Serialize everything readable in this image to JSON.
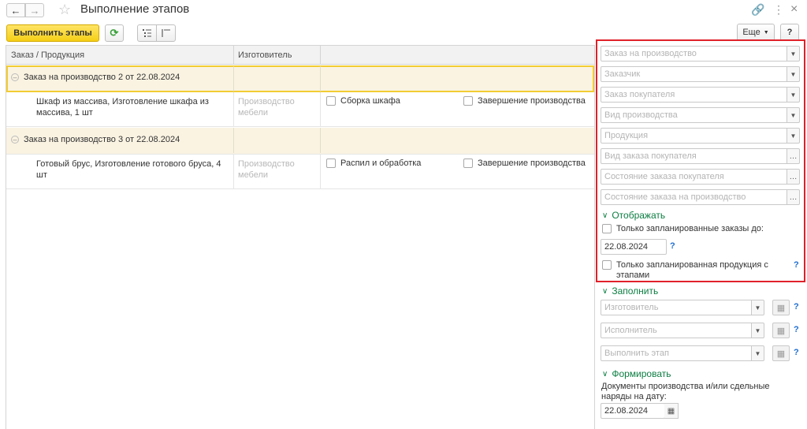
{
  "window": {
    "title": "Выполнение этапов",
    "back_icon": "←",
    "forward_icon": "→",
    "star_icon": "☆",
    "link_icon": "🔗",
    "menu_icon": "⋮",
    "close_icon": "×"
  },
  "toolbar": {
    "run_label": "Выполнить этапы",
    "refresh_icon": "⟳",
    "more_label": "Еще",
    "help_label": "?"
  },
  "table": {
    "columns": [
      "Заказ / Продукция",
      "Изготовитель"
    ],
    "groups": [
      {
        "title": "Заказ на производство 2 от 22.08.2024",
        "row": {
          "product": "Шкаф из массива, Изготовление шкафа из массива, 1 шт",
          "maker": "Производство мебели",
          "stage1": "Сборка шкафа",
          "stage2": "Завершение производства"
        }
      },
      {
        "title": "Заказ на производство 3 от 22.08.2024",
        "row": {
          "product": "Готовый брус, Изготовление готового бруса, 4 шт",
          "maker": "Производство мебели",
          "stage1": "Распил и обработка",
          "stage2": "Завершение производства"
        }
      }
    ]
  },
  "filters": {
    "production_order": "Заказ на производство",
    "customer": "Заказчик",
    "customer_order": "Заказ покупателя",
    "production_type": "Вид производства",
    "product": "Продукция",
    "customer_order_type": "Вид заказа покупателя",
    "customer_order_state": "Состояние заказа покупателя",
    "production_order_state": "Состояние заказа на производство"
  },
  "display": {
    "section": "Отображать",
    "only_planned_orders": "Только запланированные заказы до:",
    "date": "22.08.2024",
    "only_planned_products": "Только запланированная продукция с этапами"
  },
  "fill": {
    "section": "Заполнить",
    "maker": "Изготовитель",
    "executor": "Исполнитель",
    "run_stage": "Выполнить этап"
  },
  "form": {
    "section": "Формировать",
    "note": "Документы производства и/или сдельные наряды на дату:",
    "date": "22.08.2024"
  },
  "help_mark": "?"
}
